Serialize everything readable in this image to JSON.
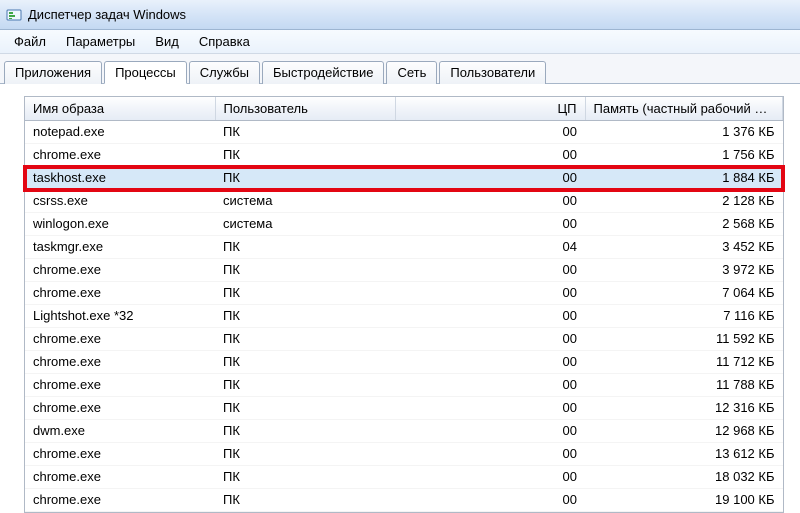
{
  "window": {
    "title": "Диспетчер задач Windows"
  },
  "menu": {
    "file": "Файл",
    "options": "Параметры",
    "view": "Вид",
    "help": "Справка"
  },
  "tabs": {
    "applications": "Приложения",
    "processes": "Процессы",
    "services": "Службы",
    "performance": "Быстродействие",
    "networking": "Сеть",
    "users": "Пользователи"
  },
  "columns": {
    "image_name": "Имя образа",
    "user": "Пользователь",
    "cpu": "ЦП",
    "memory": "Память (частный рабочий наб..."
  },
  "processes": [
    {
      "name": "notepad.exe",
      "user": "ПК",
      "cpu": "00",
      "mem": "1 376 КБ",
      "state": ""
    },
    {
      "name": "chrome.exe",
      "user": "ПК",
      "cpu": "00",
      "mem": "1 756 КБ",
      "state": ""
    },
    {
      "name": "taskhost.exe",
      "user": "ПК",
      "cpu": "00",
      "mem": "1 884 КБ",
      "state": "highlighted"
    },
    {
      "name": "csrss.exe",
      "user": "система",
      "cpu": "00",
      "mem": "2 128 КБ",
      "state": ""
    },
    {
      "name": "winlogon.exe",
      "user": "система",
      "cpu": "00",
      "mem": "2 568 КБ",
      "state": ""
    },
    {
      "name": "taskmgr.exe",
      "user": "ПК",
      "cpu": "04",
      "mem": "3 452 КБ",
      "state": ""
    },
    {
      "name": "chrome.exe",
      "user": "ПК",
      "cpu": "00",
      "mem": "3 972 КБ",
      "state": ""
    },
    {
      "name": "chrome.exe",
      "user": "ПК",
      "cpu": "00",
      "mem": "7 064 КБ",
      "state": ""
    },
    {
      "name": "Lightshot.exe *32",
      "user": "ПК",
      "cpu": "00",
      "mem": "7 116 КБ",
      "state": ""
    },
    {
      "name": "chrome.exe",
      "user": "ПК",
      "cpu": "00",
      "mem": "11 592 КБ",
      "state": ""
    },
    {
      "name": "chrome.exe",
      "user": "ПК",
      "cpu": "00",
      "mem": "11 712 КБ",
      "state": ""
    },
    {
      "name": "chrome.exe",
      "user": "ПК",
      "cpu": "00",
      "mem": "11 788 КБ",
      "state": ""
    },
    {
      "name": "chrome.exe",
      "user": "ПК",
      "cpu": "00",
      "mem": "12 316 КБ",
      "state": ""
    },
    {
      "name": "dwm.exe",
      "user": "ПК",
      "cpu": "00",
      "mem": "12 968 КБ",
      "state": ""
    },
    {
      "name": "chrome.exe",
      "user": "ПК",
      "cpu": "00",
      "mem": "13 612 КБ",
      "state": ""
    },
    {
      "name": "chrome.exe",
      "user": "ПК",
      "cpu": "00",
      "mem": "18 032 КБ",
      "state": ""
    },
    {
      "name": "chrome.exe",
      "user": "ПК",
      "cpu": "00",
      "mem": "19 100 КБ",
      "state": ""
    }
  ]
}
